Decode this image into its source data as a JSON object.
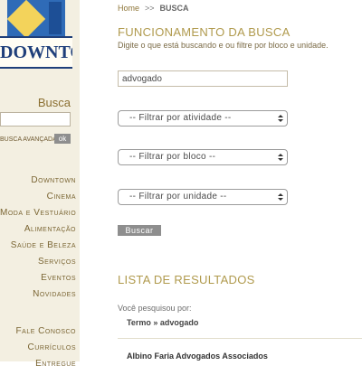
{
  "logo": {
    "text": "DOWNTOWN"
  },
  "sidebar": {
    "search_label": "Busca",
    "advanced_search": "BUSCA AVANÇADA",
    "ok_label": "ok",
    "menu": [
      "Downtown",
      "Cinema",
      "Moda e Vestuário",
      "Alimentação",
      "Saúde e Beleza",
      "Serviços",
      "Eventos",
      "Novidades"
    ],
    "menu_secondary": [
      "Fale Conosco",
      "Currículos",
      "Entregue"
    ]
  },
  "breadcrumb": {
    "home": "Home",
    "separator": ">>",
    "current": "BUSCA"
  },
  "main": {
    "section_title": "FUNCIONAMENTO DA BUSCA",
    "description": "Digite o que está buscando e ou filtre por bloco e unidade.",
    "query_value": "advogado",
    "filters": [
      "-- Filtrar por atividade --",
      "-- Filtrar por bloco --",
      "-- Filtrar por unidade --"
    ],
    "button_label": "Buscar",
    "results_title": "LISTA DE RESULTADOS",
    "searched_label": "Você pesquisou por:",
    "term": "Termo » advogado",
    "results": [
      "Albino Faria Advogados Associados"
    ]
  },
  "colors": {
    "sidebar_bg": "#f3efe1",
    "accent_gold": "#b09a4d",
    "menu_text": "#7a6533",
    "logo_blue": "#1f3f7a"
  }
}
